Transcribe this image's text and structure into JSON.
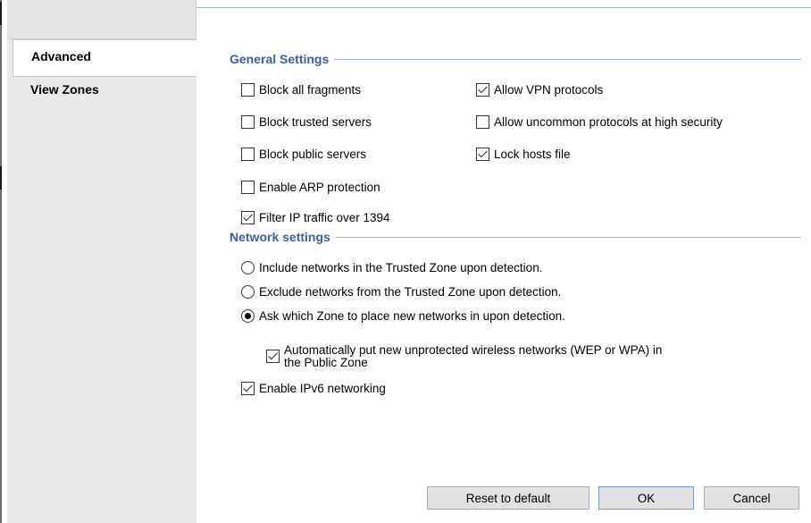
{
  "tabs": [
    {
      "label": "Advanced",
      "active": true
    },
    {
      "label": "View Zones",
      "active": false
    }
  ],
  "general_settings": {
    "title": "General Settings",
    "left_options": [
      {
        "label": "Block all fragments",
        "checked": false
      },
      {
        "label": "Block trusted servers",
        "checked": false
      },
      {
        "label": "Block public servers",
        "checked": false
      },
      {
        "label": "Enable ARP protection",
        "checked": false
      },
      {
        "label": "Filter IP traffic over 1394",
        "checked": true
      }
    ],
    "right_options": [
      {
        "label": "Allow VPN protocols",
        "checked": true
      },
      {
        "label": "Allow uncommon protocols at high security",
        "checked": false
      },
      {
        "label": "Lock hosts file",
        "checked": true
      }
    ]
  },
  "network_settings": {
    "title": "Network settings",
    "radios": [
      {
        "label": "Include networks in the Trusted Zone upon detection.",
        "selected": false
      },
      {
        "label": "Exclude networks from the Trusted Zone upon detection.",
        "selected": false
      },
      {
        "label": "Ask which Zone to place new networks in upon detection.",
        "selected": true
      }
    ],
    "wireless_option": {
      "line1": "Automatically put new unprotected wireless networks (WEP or WPA) in",
      "line2": "the Public Zone",
      "checked": true
    },
    "ipv6_option": {
      "label": "Enable IPv6 networking",
      "checked": true
    }
  },
  "buttons": {
    "reset": "Reset to default",
    "ok": "OK",
    "cancel": "Cancel"
  }
}
